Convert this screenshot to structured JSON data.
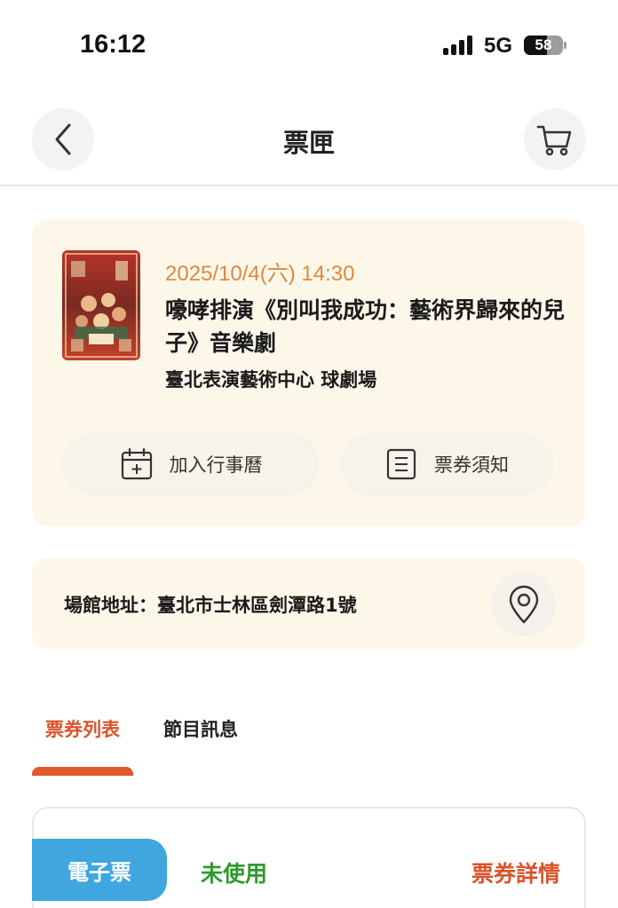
{
  "status_bar": {
    "time": "16:12",
    "network": "5G",
    "battery": "58",
    "battery_level": 0.58
  },
  "header": {
    "title": "票匣",
    "back_icon": "chevron-left-icon",
    "cart_icon": "cart-icon"
  },
  "event": {
    "datetime": "2025/10/4(六) 14:30",
    "title": "嚎哮排演《別叫我成功：藝術界歸來的兒子》音樂劇",
    "venue": "臺北表演藝術中心 球劇場",
    "add_calendar_label": "加入行事曆",
    "ticket_notice_label": "票券須知"
  },
  "address": {
    "text": "場館地址：臺北市士林區劍潭路1號"
  },
  "tabs": [
    {
      "label": "票券列表",
      "active": true
    },
    {
      "label": "節目訊息",
      "active": false
    }
  ],
  "ticket": {
    "type": "電子票",
    "status": "未使用",
    "detail_label": "票券詳情"
  },
  "colors": {
    "accent": "#e05a2e",
    "date": "#e0883a",
    "card_bg": "#fdf7ea",
    "ticket_type_bg": "#3fa6e0",
    "status_green": "#2e9a2c"
  }
}
